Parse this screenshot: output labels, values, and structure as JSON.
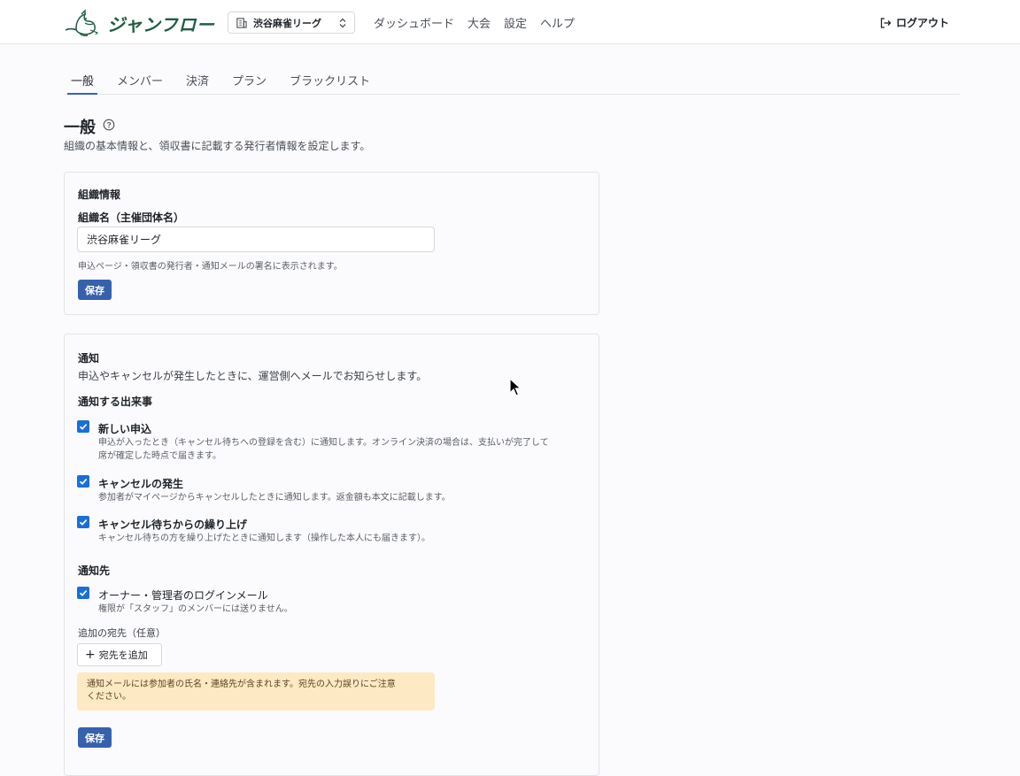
{
  "header": {
    "logo_text": "ジャンフロー",
    "org_switcher": {
      "value": "渋谷麻雀リーグ",
      "icon": "building-icon",
      "chevron": "chevron-up-down-icon"
    },
    "nav": [
      {
        "label": "ダッシュボード"
      },
      {
        "label": "大会"
      },
      {
        "label": "設定"
      },
      {
        "label": "ヘルプ"
      }
    ],
    "logout_label": "ログアウト",
    "logout_icon": "logout-icon"
  },
  "tabs": [
    {
      "label": "一般",
      "active": true
    },
    {
      "label": "メンバー",
      "active": false
    },
    {
      "label": "決済",
      "active": false
    },
    {
      "label": "プラン",
      "active": false
    },
    {
      "label": "ブラックリスト",
      "active": false
    }
  ],
  "page": {
    "title": "一般",
    "description": "組織の基本情報と、領収書に記載する発行者情報を設定します。"
  },
  "org_info": {
    "section_title": "組織情報",
    "field_label": "組織名（主催団体名）",
    "field_value": "渋谷麻雀リーグ",
    "hint": "申込ページ・領収書の発行者・通知メールの署名に表示されます。",
    "save_label": "保存"
  },
  "notification": {
    "section_title": "通知",
    "description": "申込やキャンセルが発生したときに、運営側へメールでお知らせします。",
    "events_heading": "通知する出来事",
    "events": [
      {
        "title": "新しい申込",
        "desc_line1": "申込が入ったとき（キャンセル待ちへの登録を含む）に通知します。オンライン決済の場合は、支払いが完了して",
        "desc_line2": "席が確定した時点で届きます。",
        "checked": true
      },
      {
        "title": "キャンセルの発生",
        "desc_line1": "参加者がマイページからキャンセルしたときに通知します。返金額も本文に記載します。",
        "checked": true
      },
      {
        "title": "キャンセル待ちからの繰り上げ",
        "desc_line1": "キャンセル待ちの方を繰り上げたときに通知します（操作した本人にも届きます）。",
        "checked": true
      }
    ],
    "recipients_heading": "通知先",
    "owner_option": {
      "title": "オーナー・管理者のログインメール",
      "desc": "権限が「スタッフ」のメンバーには送りません。",
      "checked": true
    },
    "additional_label": "追加の宛先（任意）",
    "add_button_label": "宛先を追加",
    "warning_line1": "通知メールには参加者の氏名・連絡先が含まれます。宛先の入力誤りにご注意",
    "warning_line2": "ください。",
    "save_label": "保存"
  },
  "colors": {
    "brand": "#1f5e45",
    "primary_button": "#3761ad",
    "checkbox": "#1a6fd6",
    "warning_bg": "#fde9c4",
    "active_tab_underline": "#3563b8"
  }
}
